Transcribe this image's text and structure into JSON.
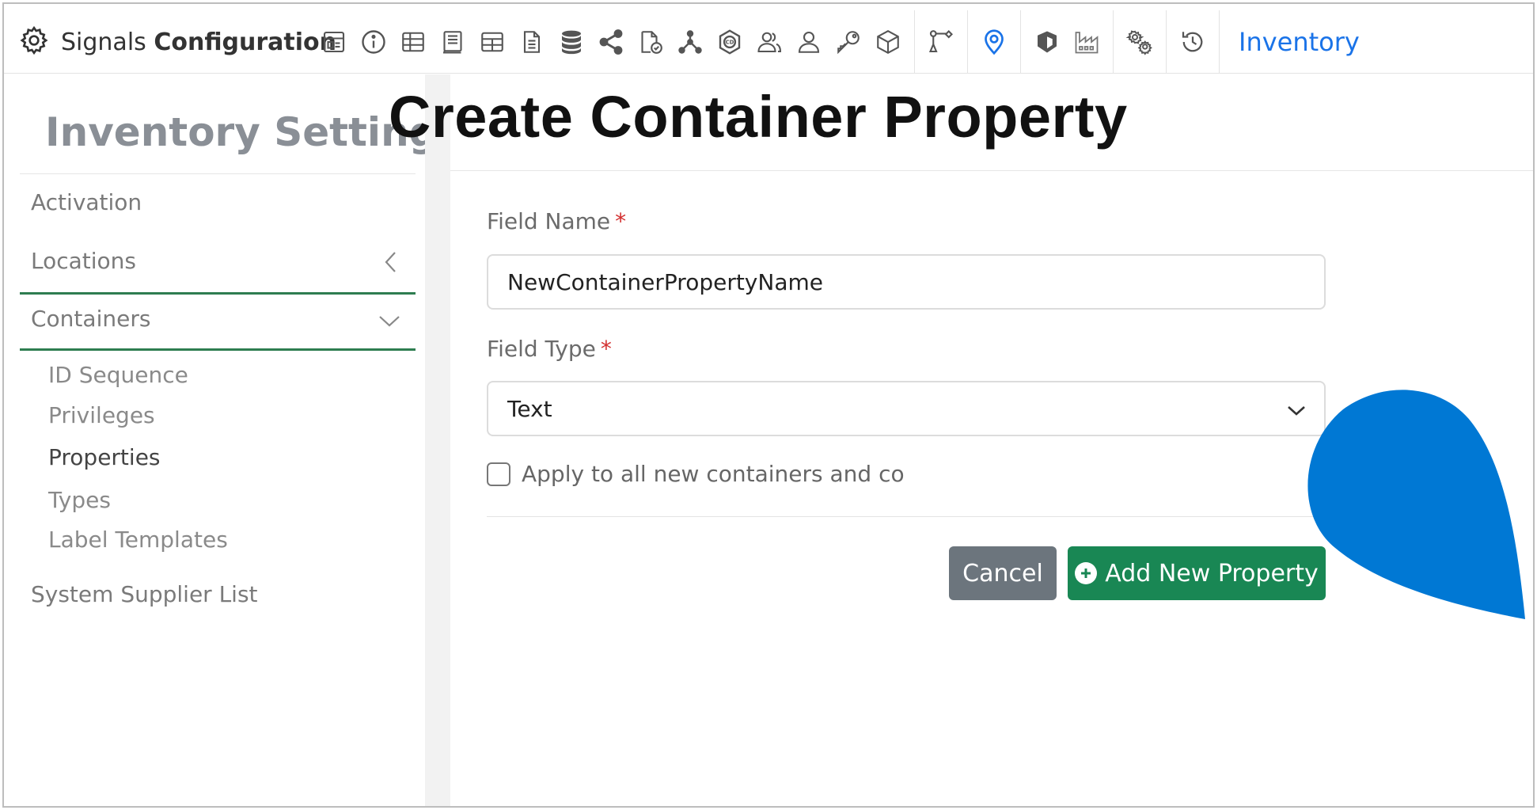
{
  "topnav": {
    "brand_prefix": "Signals ",
    "brand_bold": "Configuration",
    "inventory_link": "Inventory",
    "icons": [
      "layout-icon",
      "info-icon",
      "table-icon",
      "book-icon",
      "grid-icon",
      "document-icon",
      "database-icon",
      "share-icon",
      "file-check-icon",
      "hierarchy-icon",
      "cd-icon",
      "users-icon",
      "user-icon",
      "key-icon",
      "cube-icon",
      "workflow-icon",
      "map-pin-icon",
      "shield-icon",
      "factory-icon",
      "gears-icon",
      "history-icon"
    ]
  },
  "sidebar": {
    "title": "Inventory Settings",
    "items": [
      {
        "label": "Activation"
      },
      {
        "label": "Locations"
      },
      {
        "label": "Containers"
      }
    ],
    "sub_items": [
      {
        "label": "ID Sequence"
      },
      {
        "label": "Privileges"
      },
      {
        "label": "Properties"
      },
      {
        "label": "Types"
      },
      {
        "label": "Label Templates"
      }
    ],
    "bottom_item": "System Supplier List"
  },
  "main": {
    "title": "Create Container Property",
    "field_name": {
      "label": "Field Name",
      "required": "*",
      "value": "NewContainerPropertyName"
    },
    "field_type": {
      "label": "Field Type",
      "required": "*",
      "value": "Text"
    },
    "apply_checkbox": {
      "label": "Apply to all new containers and co",
      "checked": false
    },
    "cancel_button": "Cancel",
    "add_button": "Add New Property"
  },
  "colors": {
    "accent_green": "#198754",
    "cancel_gray": "#6c757d",
    "link_blue": "#1a73e8",
    "pointer_blue": "#0078d4"
  }
}
